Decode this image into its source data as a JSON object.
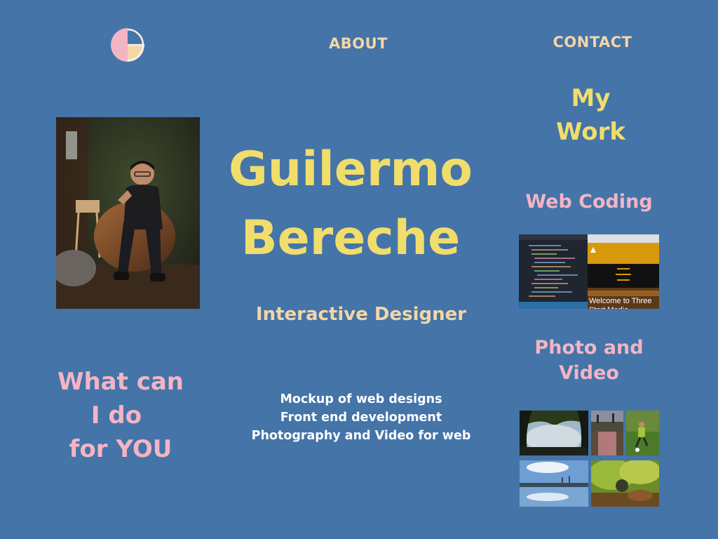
{
  "logo": {
    "icon": "g-monogram-icon",
    "colors": [
      "#f4b4c4",
      "#f3d6a6",
      "#ffffff"
    ]
  },
  "nav": {
    "about": "ABOUT",
    "contact": "CONTACT"
  },
  "hero": {
    "first_name": "Guilermo",
    "last_name": "Bereche",
    "subtitle": "Interactive Designer",
    "portrait": "portrait-photo"
  },
  "cta": {
    "line1": "What can",
    "line2": "I do",
    "line3": "for YOU"
  },
  "services": [
    "Mockup of web designs",
    "Front end development",
    "Photography and Video for web"
  ],
  "portfolio": {
    "heading_line1": "My",
    "heading_line2": "Work",
    "web_coding": "Web Coding",
    "web_thumb_caption": "Welcome to Three Start Media",
    "photo_video_line1": "Photo and",
    "photo_video_line2": "Video"
  },
  "colors": {
    "background": "#4474a8",
    "yellow": "#f0dd6c",
    "pink": "#f4b4c4",
    "cream": "#f3d6a6",
    "white": "#ffffff"
  }
}
